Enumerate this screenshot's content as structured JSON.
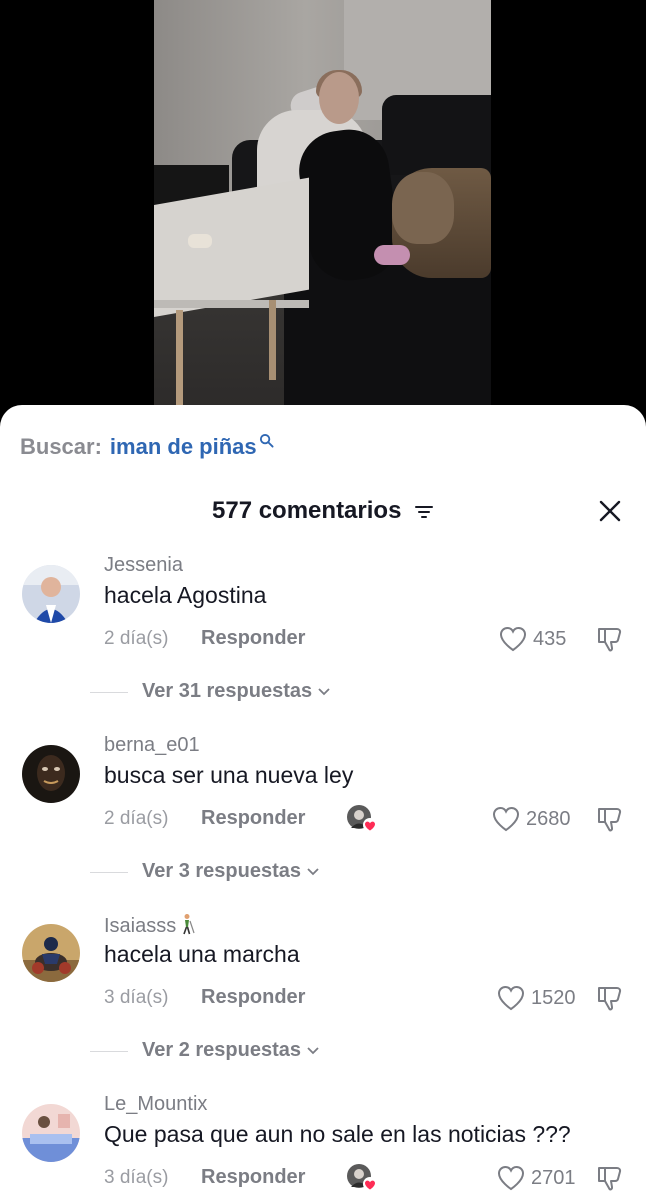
{
  "search": {
    "label": "Buscar:",
    "term": "iman de piñas",
    "icon": "search-icon"
  },
  "comments_header": {
    "count_label": "577 comentarios"
  },
  "comments": [
    {
      "username": "Jessenia",
      "text": "hacela Agostina",
      "time": "2 día(s)",
      "reply_label": "Responder",
      "likes": "435",
      "creator_liked": false,
      "view_replies": "Ver 31 respuestas"
    },
    {
      "username": "berna_e01",
      "text": "busca ser una nueva ley",
      "time": "2 día(s)",
      "reply_label": "Responder",
      "likes": "2680",
      "creator_liked": true,
      "view_replies": "Ver 3 respuestas"
    },
    {
      "username": "Isaiasss",
      "text": "hacela una marcha",
      "time": "3 día(s)",
      "reply_label": "Responder",
      "likes": "1520",
      "creator_liked": false,
      "view_replies": "Ver 2 respuestas"
    },
    {
      "username": "Le_Mountix",
      "text": "Que pasa que aun no sale en las noticias ???",
      "time": "3 día(s)",
      "reply_label": "Responder",
      "likes": "2701",
      "creator_liked": true,
      "view_replies": ""
    }
  ],
  "colors": {
    "search_term": "#2f67b3",
    "text_primary": "#161823",
    "text_secondary": "#7b7d84",
    "heart_badge": "#fe2c55"
  }
}
